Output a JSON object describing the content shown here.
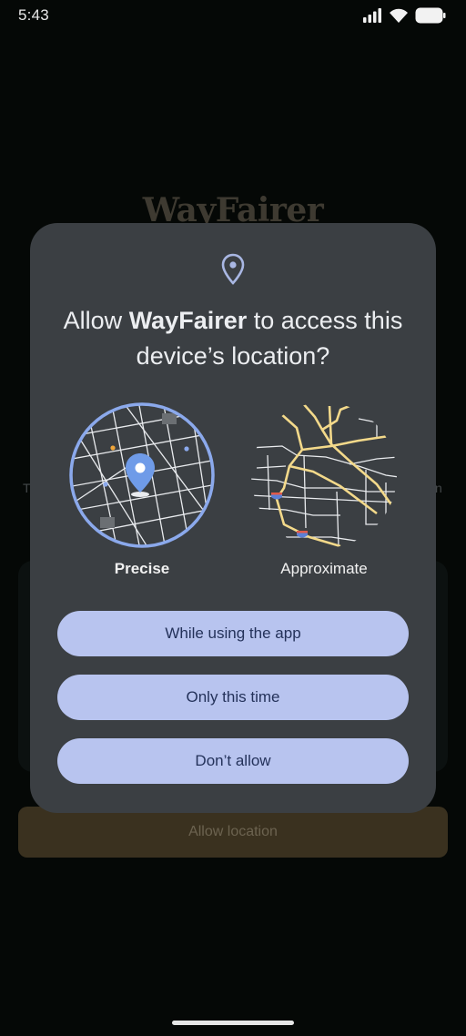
{
  "status_bar": {
    "time": "5:43"
  },
  "background": {
    "logo": "WayFairer",
    "side_left": "T",
    "side_right": "n",
    "button_label": "Allow location"
  },
  "dialog": {
    "title_prefix": "Allow ",
    "app_name": "WayFairer",
    "title_suffix": " to access this device’s location?",
    "option_precise": "Precise",
    "option_approximate": "Approximate",
    "btn_while_using": "While using the app",
    "btn_only_this_time": "Only this time",
    "btn_dont_allow": "Don’t allow"
  },
  "colors": {
    "dialog_bg": "#3b3f43",
    "button_bg": "#b8c4ef",
    "button_text": "#24325a",
    "accent_blue": "#8ba9ec",
    "road_yellow": "#f3d98a"
  },
  "icons": [
    "signal-icon",
    "wifi-icon",
    "battery-icon",
    "location-pin-icon"
  ]
}
